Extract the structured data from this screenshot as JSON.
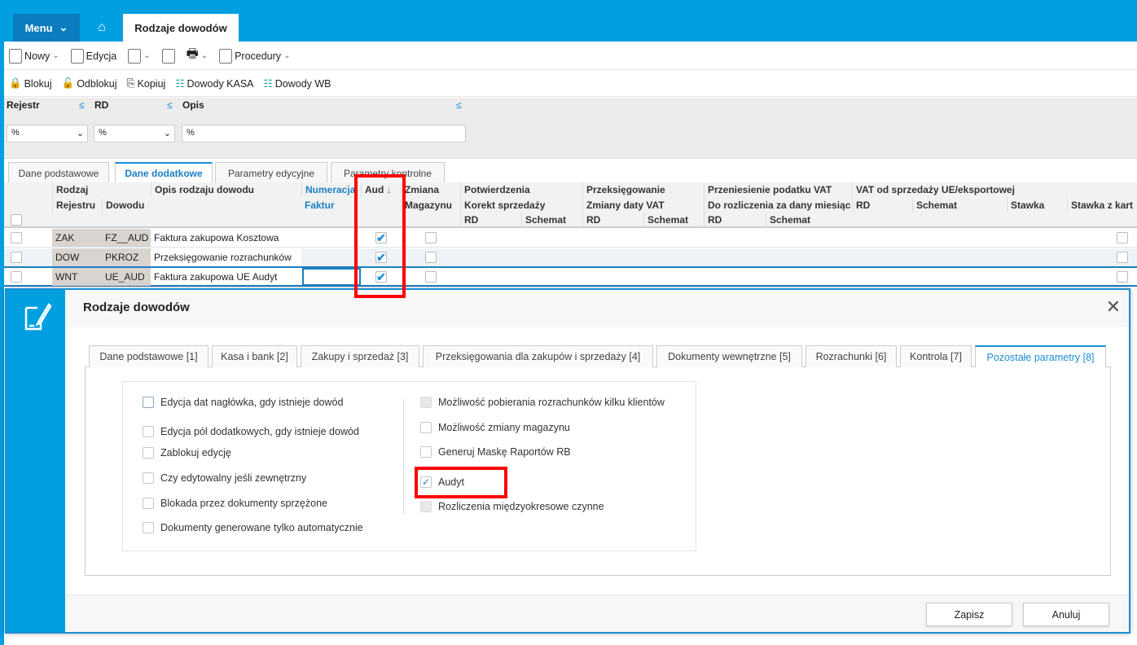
{
  "app": {
    "menu_label": "Menu",
    "page_tab": "Rodzaje dowodów"
  },
  "toolbar1": {
    "new": "Nowy",
    "edit": "Edycja",
    "procedures": "Procedury"
  },
  "toolbar2": {
    "lock": "Blokuj",
    "unlock": "Odblokuj",
    "copy": "Kopiuj",
    "kasa": "Dowody KASA",
    "wb": "Dowody WB"
  },
  "filters": [
    {
      "label": "Rejestr",
      "value": "%"
    },
    {
      "label": "RD",
      "value": "%"
    },
    {
      "label": "Opis",
      "value": "%"
    }
  ],
  "grid_tabs": [
    "Dane podstawowe",
    "Dane dodatkowe",
    "Parametry edycyjne",
    "Parametry kontrolne"
  ],
  "grid_headers": {
    "rodzaj": "Rodzaj",
    "rejestru": "Rejestru",
    "dowodu": "Dowodu",
    "opis": "Opis rodzaju dowodu",
    "numeracja": "Numeracja",
    "faktur": "Faktur",
    "aud": "Aud",
    "zmiana": "Zmiana",
    "magazynu": "Magazynu",
    "potw": "Potwierdzenia",
    "korekt": "Korekt sprzedaży",
    "przeks": "Przeksięgowanie",
    "zmiany": "Zmiany daty VAT",
    "przen": "Przeniesienie podatku VAT",
    "dorozl": "Do rozliczenia za dany miesiąc",
    "vatue": "VAT od sprzedaży UE/eksportowej",
    "rd": "RD",
    "schemat": "Schemat",
    "stawka": "Stawka",
    "stawkakart": "Stawka z kart"
  },
  "rows": [
    {
      "rejestr": "ZAK",
      "dowod": "FZ__AUD",
      "opis": "Faktura zakupowa Kosztowa",
      "audyt": true,
      "magazyn": false
    },
    {
      "rejestr": "DOW",
      "dowod": "PKROZ",
      "opis": "Przeksięgowanie rozrachunków",
      "audyt": true,
      "magazyn": false
    },
    {
      "rejestr": "WNT",
      "dowod": "UE_AUD",
      "opis": "Faktura zakupowa UE Audyt",
      "audyt": true,
      "magazyn": false
    }
  ],
  "dialog": {
    "title": "Rodzaje dowodów",
    "tabs": [
      "Dane podstawowe [1]",
      "Kasa i bank [2]",
      "Zakupy i sprzedaż [3]",
      "Przeksięgowania dla zakupów i sprzedaży [4]",
      "Dokumenty wewnętrzne [5]",
      "Rozrachunki [6]",
      "Kontrola [7]",
      "Pozostałe parametry [8]"
    ],
    "active_tab": "Pozostałe parametry [8]",
    "left_options": [
      {
        "label": "Edycja dat nagłówka, gdy istnieje dowód",
        "checked": false
      },
      {
        "label": "Edycja pól dodatkowych, gdy istnieje dowód",
        "checked": false
      },
      {
        "label": "Zablokuj edycję",
        "checked": false
      },
      {
        "label": "Czy edytowalny jeśli zewnętrzny",
        "checked": false
      },
      {
        "label": "Blokada przez dokumenty sprzężone",
        "checked": false
      },
      {
        "label": "Dokumenty generowane tylko automatycznie",
        "checked": false
      }
    ],
    "right_options": [
      {
        "label": "Możliwość pobierania rozrachunków kilku klientów",
        "checked": false,
        "disabled": true
      },
      {
        "label": "Możliwość zmiany magazynu",
        "checked": false
      },
      {
        "label": "Generuj Maskę Raportów RB",
        "checked": false
      },
      {
        "label": "Audyt",
        "checked": true
      },
      {
        "label": "Rozliczenia międzyokresowe czynne",
        "checked": false,
        "disabled": true
      }
    ],
    "save": "Zapisz",
    "cancel": "Anuluj"
  },
  "colors": {
    "accent": "#009fe0",
    "highlight": "#ff0000"
  }
}
